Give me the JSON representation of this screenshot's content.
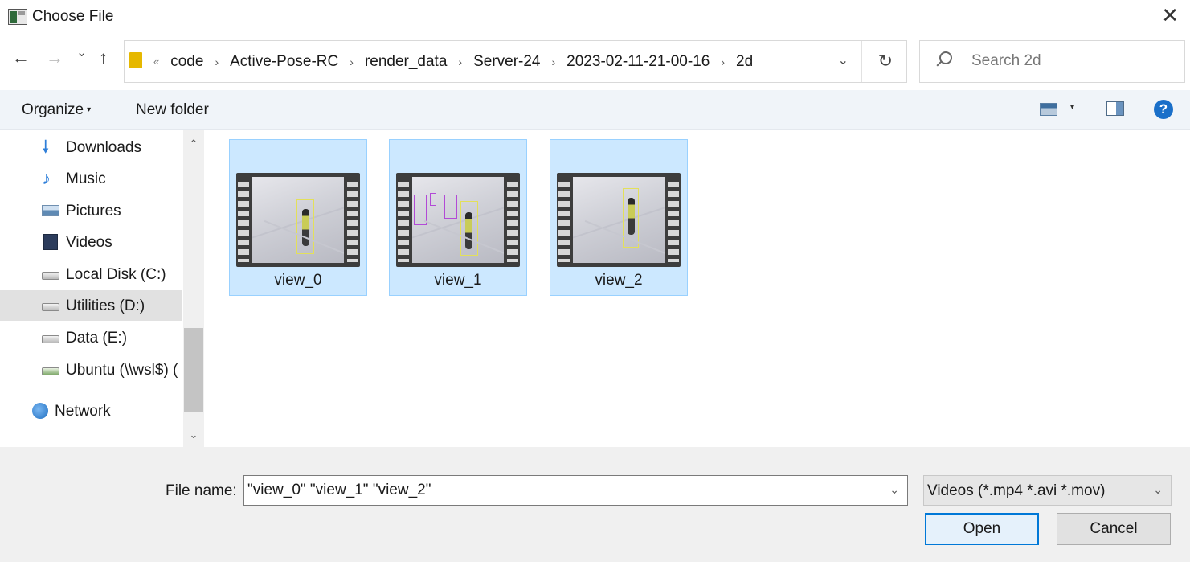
{
  "window": {
    "title": "Choose File",
    "close_symbol": "✕"
  },
  "nav": {
    "back_symbol": "←",
    "forward_symbol": "→",
    "recent_symbol": "⌄",
    "up_symbol": "↑",
    "path_overflow_symbol": "«",
    "path_separator": "›",
    "breadcrumbs": [
      "code",
      "Active-Pose-RC",
      "render_data",
      "Server-24",
      "2023-02-11-21-00-16",
      "2d"
    ],
    "address_dropdown_symbol": "⌄",
    "refresh_symbol": "↻",
    "search_placeholder": "Search 2d"
  },
  "toolbar": {
    "organize_label": "Organize",
    "organize_caret": "▾",
    "new_folder_label": "New folder",
    "view_caret": "▾",
    "help_symbol": "?"
  },
  "sidebar": {
    "items": [
      {
        "label": "Downloads",
        "icon": "download-arrow-icon"
      },
      {
        "label": "Music",
        "icon": "music-note-icon"
      },
      {
        "label": "Pictures",
        "icon": "pictures-icon"
      },
      {
        "label": "Videos",
        "icon": "videos-icon"
      },
      {
        "label": "Local Disk (C:)",
        "icon": "drive-icon"
      },
      {
        "label": "Utilities (D:)",
        "icon": "drive-icon",
        "selected": true
      },
      {
        "label": "Data (E:)",
        "icon": "drive-icon"
      },
      {
        "label": "Ubuntu (\\\\wsl$) (",
        "icon": "network-drive-icon"
      },
      {
        "label": "Network",
        "icon": "network-icon"
      }
    ],
    "scroll_up_symbol": "⌃",
    "scroll_down_symbol": "⌄"
  },
  "files": [
    {
      "name": "view_0",
      "selected": true
    },
    {
      "name": "view_1",
      "selected": true
    },
    {
      "name": "view_2",
      "selected": true
    }
  ],
  "bottom": {
    "file_name_label": "File name:",
    "file_name_value": "\"view_0\" \"view_1\" \"view_2\"",
    "file_name_dropdown_symbol": "⌄",
    "file_type_value": "Videos (*.mp4 *.avi *.mov)",
    "file_type_dropdown_symbol": "⌄",
    "open_label": "Open",
    "cancel_label": "Cancel"
  },
  "colors": {
    "selection_fill": "#cce8ff",
    "selection_border": "#99d1ff",
    "toolbar_bg": "#f0f4f9",
    "accent": "#0078d7"
  }
}
